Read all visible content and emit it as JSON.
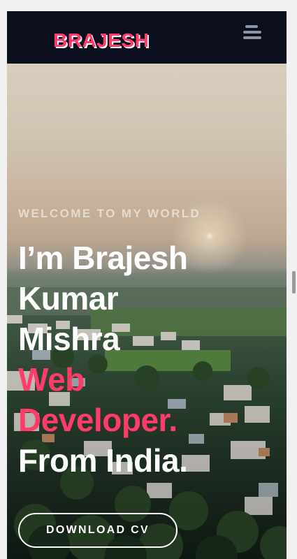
{
  "header": {
    "brand": "BRAJESH",
    "menu_icon": "hamburger-icon"
  },
  "hero": {
    "subtitle": "WELCOME TO MY WORLD",
    "line1": "I’m Brajesh",
    "line2": "Kumar",
    "line3": "Mishra",
    "line4": "Web",
    "line5": "Developer.",
    "line6": "From India.",
    "cta_label": "DOWNLOAD CV"
  },
  "colors": {
    "accent": "#ff3b6a",
    "navbar": "#0b0f1d",
    "text": "#ffffff"
  }
}
